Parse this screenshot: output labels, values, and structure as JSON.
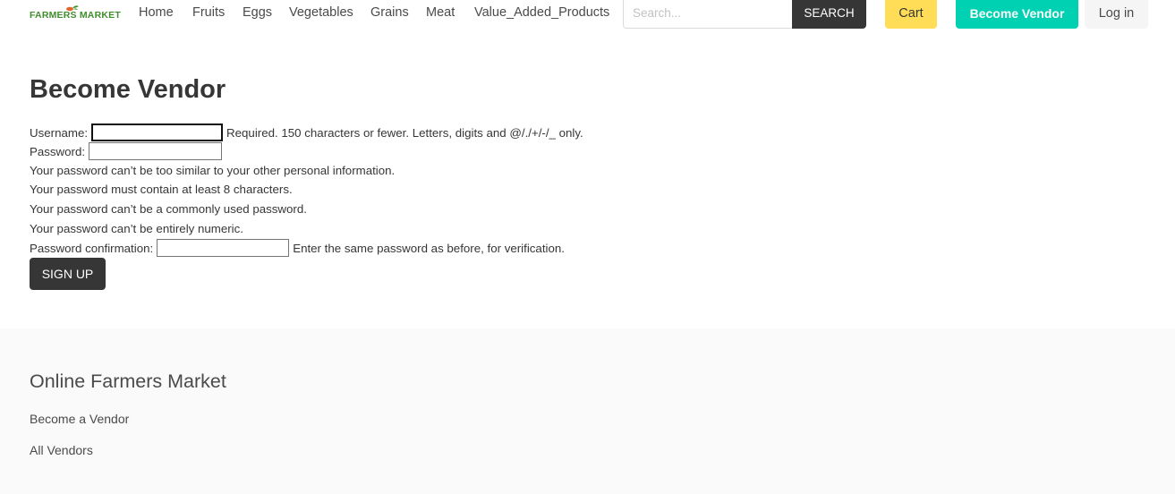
{
  "brand": {
    "logo_text": "FARMERS MARKET"
  },
  "nav": {
    "links": [
      "Home",
      "Fruits",
      "Eggs",
      "Vegetables",
      "Grains",
      "Meat",
      "Value_Added_Products"
    ]
  },
  "search": {
    "placeholder": "Search...",
    "button_label": "SEARCH"
  },
  "header_buttons": {
    "cart_label": "Cart",
    "become_vendor_label": "Become Vendor",
    "login_label": "Log in"
  },
  "colors": {
    "cart": "#ffdd57",
    "become_vendor": "#00d1b2",
    "dark_button": "#363636",
    "logo": "#3f8f2c"
  },
  "main": {
    "title": "Become Vendor",
    "username_label": "Username:",
    "username_value": "",
    "username_help": "Required. 150 characters or fewer. Letters, digits and @/./+/-/_ only.",
    "password_label": "Password:",
    "password_value": "",
    "password_rules": [
      "Your password can’t be too similar to your other personal information.",
      "Your password must contain at least 8 characters.",
      "Your password can’t be a commonly used password.",
      "Your password can’t be entirely numeric."
    ],
    "confirm_label": "Password confirmation:",
    "confirm_value": "",
    "confirm_help": "Enter the same password as before, for verification.",
    "signup_label": "SIGN UP"
  },
  "footer": {
    "title": "Online Farmers Market",
    "links": [
      "Become a Vendor",
      "All Vendors"
    ]
  }
}
